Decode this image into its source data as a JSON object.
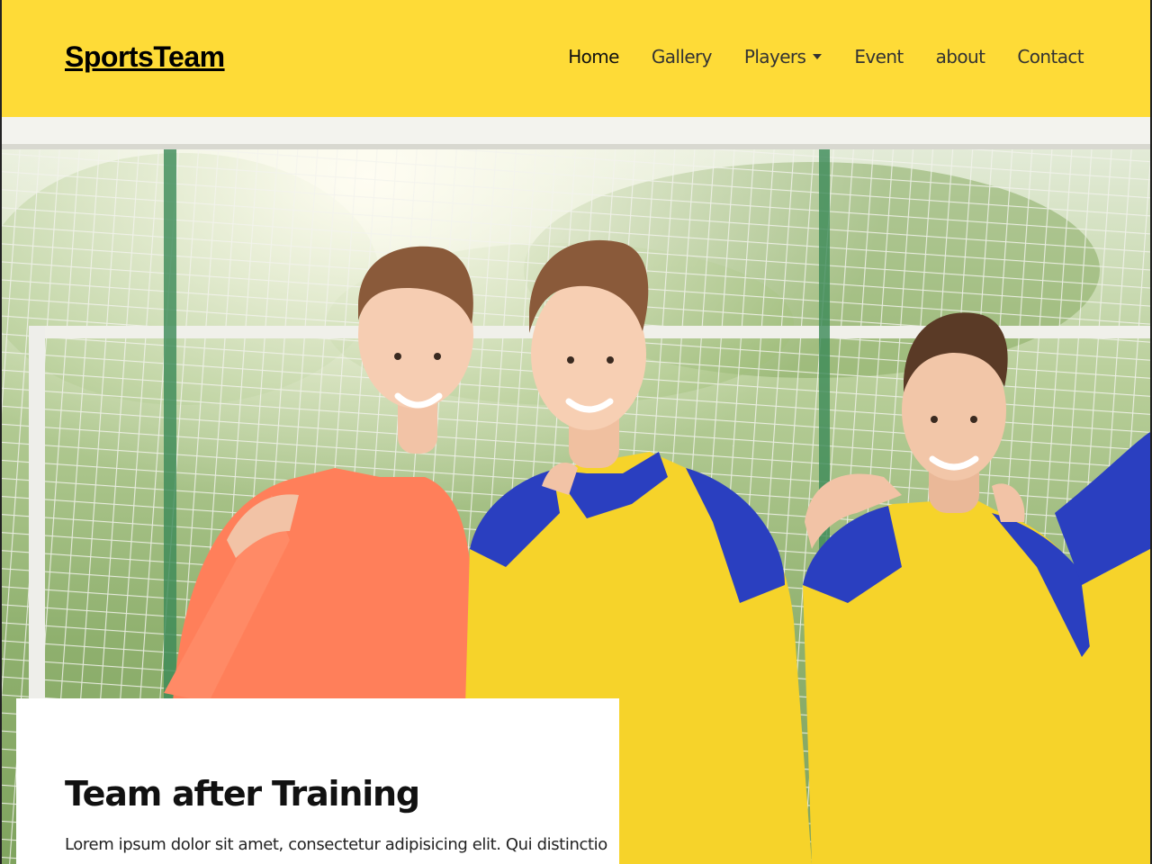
{
  "navbar": {
    "brand": "SportsTeam",
    "links": [
      {
        "label": "Home"
      },
      {
        "label": "Gallery"
      },
      {
        "label": "Players"
      },
      {
        "label": "Event"
      },
      {
        "label": "about"
      },
      {
        "label": "Contact"
      }
    ],
    "players_has_dropdown": true
  },
  "hero": {
    "image_icon": "team-photo",
    "caption": {
      "title": "Team after Training",
      "text": "Lorem ipsum dolor sit amet, consectetur adipisicing elit. Qui distinctio"
    }
  },
  "colors": {
    "navbar_background": "#fedb37",
    "jersey_yellow": "#f6d32a",
    "jersey_blue": "#2a3fc0",
    "jersey_orange": "#ff7f5a"
  }
}
